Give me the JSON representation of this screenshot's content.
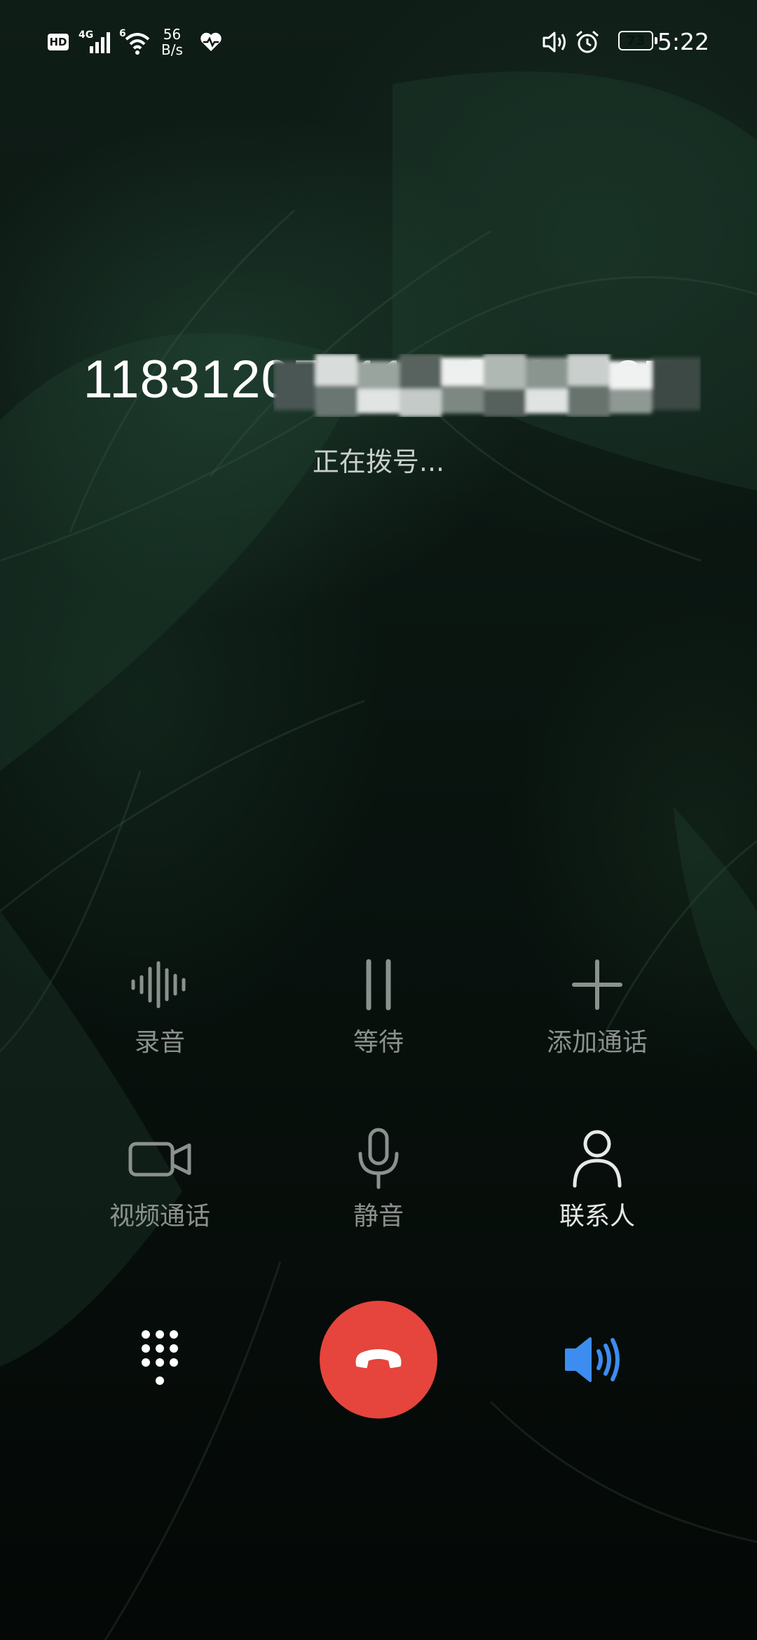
{
  "status_bar": {
    "hd_label": "HD",
    "network_type": "4G",
    "wifi_gen": "6",
    "net_speed_value": "56",
    "net_speed_unit": "B/s",
    "battery_level": "73",
    "battery_fraction": 0.73,
    "time": "5:22",
    "icons": [
      "hd-icon",
      "signal-icon",
      "wifi-icon",
      "heart-health-icon",
      "volume-icon",
      "alarm-icon",
      "battery-icon"
    ]
  },
  "call": {
    "number": "11831205211118829527",
    "status": "正在拨号..."
  },
  "actions": {
    "record": {
      "label": "录音",
      "icon": "record-waveform-icon",
      "enabled": false
    },
    "hold": {
      "label": "等待",
      "icon": "pause-icon",
      "enabled": false
    },
    "add_call": {
      "label": "添加通话",
      "icon": "plus-icon",
      "enabled": false
    },
    "video_call": {
      "label": "视频通话",
      "icon": "video-camera-icon",
      "enabled": false
    },
    "mute": {
      "label": "静音",
      "icon": "microphone-icon",
      "enabled": false
    },
    "contacts": {
      "label": "联系人",
      "icon": "person-icon",
      "enabled": true
    }
  },
  "bottom": {
    "keypad_icon": "dialpad-icon",
    "hangup_icon": "end-call-icon",
    "speaker_icon": "speaker-icon",
    "hangup_color": "#e5453d",
    "speaker_color": "#3d8df0"
  }
}
